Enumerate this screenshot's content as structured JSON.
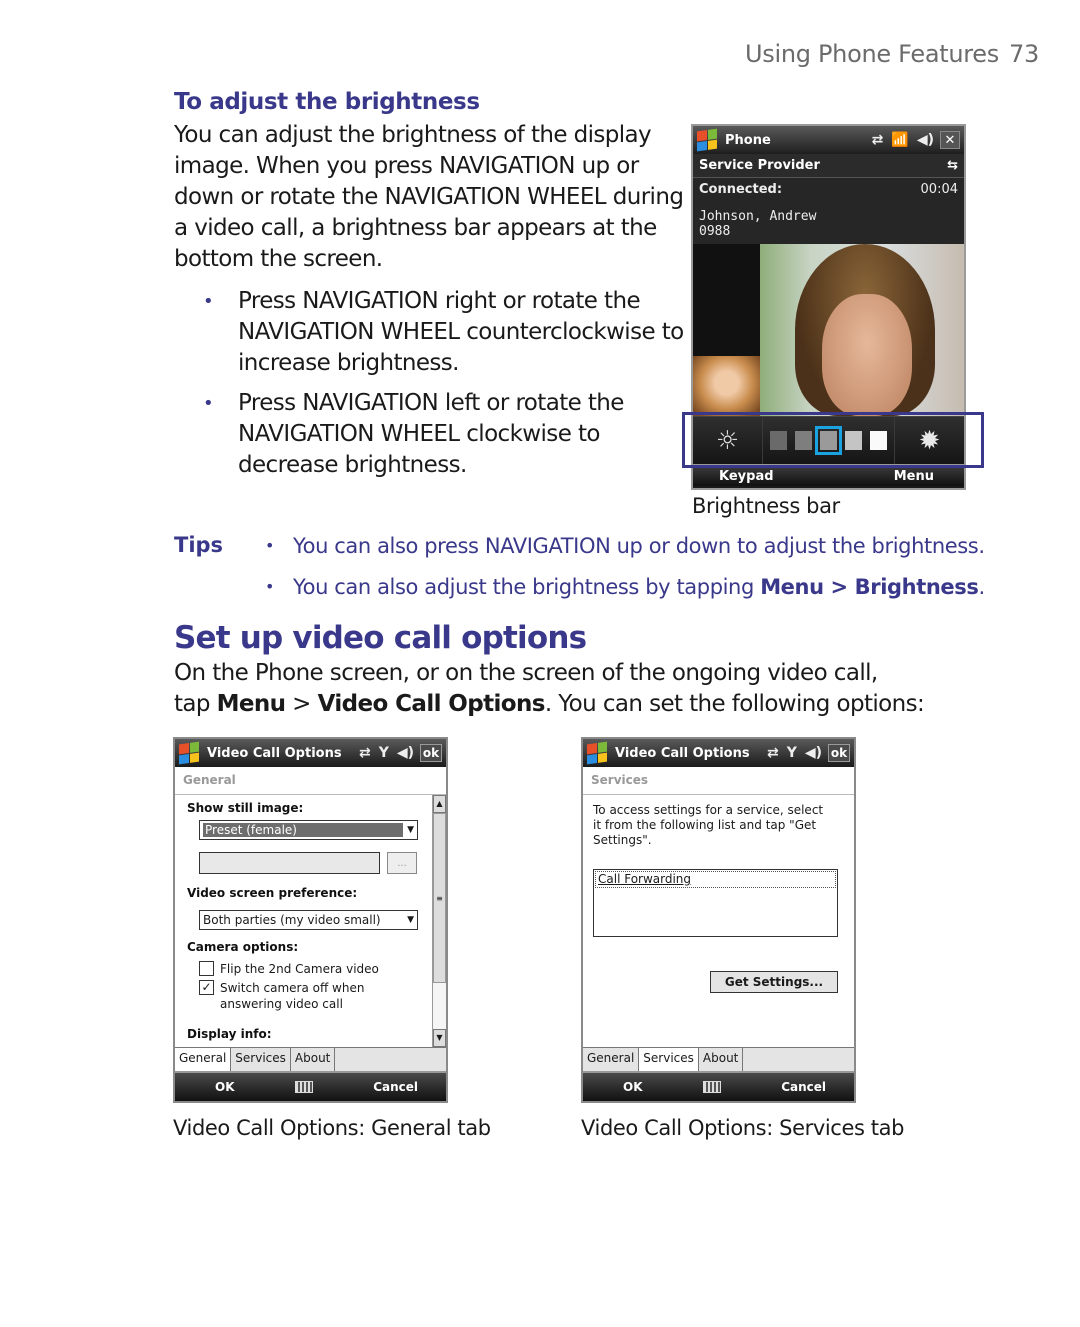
{
  "running_head": {
    "title": "Using Phone Features",
    "page": "73"
  },
  "brightness_section": {
    "heading": "To adjust the brightness",
    "intro": "You can adjust the brightness of the display image. When you press NAVIGATION up or down or rotate the NAVIGATION WHEEL during a video call, a brightness bar appears at the bottom the screen.",
    "bullets": [
      "Press NAVIGATION right or rotate the NAVIGATION WHEEL counterclockwise to increase brightness.",
      "Press NAVIGATION left or rotate the NAVIGATION WHEEL clockwise to decrease brightness."
    ]
  },
  "phone_screen": {
    "title": "Phone",
    "service_provider": "Service Provider",
    "status": "Connected:",
    "timer": "00:04",
    "contact_name": "Johnson, Andrew",
    "contact_number": "0988",
    "brightness_levels": [
      "#6a6a6a",
      "#7e7e7e",
      "#9a9a9a",
      "#c4c4c4",
      "#fafafa"
    ],
    "brightness_selected_index": 2,
    "brightness_level_count": 5,
    "softkeys": {
      "left": "Keypad",
      "right": "Menu"
    },
    "icons": {
      "close": "✕",
      "sun_dim": "☼",
      "sun_bright": "✹"
    }
  },
  "brightness_caption": "Brightness bar",
  "tips": {
    "label": "Tips",
    "items": [
      {
        "text": "You can also press NAVIGATION up or down to adjust the brightness."
      },
      {
        "pre": "You can also adjust the brightness by tapping ",
        "b1": "Menu",
        "mid": " > ",
        "b2": "Brightness",
        "post": "."
      }
    ]
  },
  "video_options_section": {
    "heading": "Set up video call options",
    "line1": "On the Phone screen, or on the screen of the ongoing video call,",
    "pre": "tap ",
    "b1": "Menu",
    "mid": " > ",
    "b2": "Video Call Options",
    "post": ". You can set the following options:"
  },
  "general_dialog": {
    "title": "Video Call Options",
    "ok": "ok",
    "subtitle": "General",
    "show_still_image_label": "Show still image:",
    "still_image_value": "Preset (female)",
    "ellipsis": "...",
    "video_pref_label": "Video screen preference:",
    "video_pref_value": "Both parties (my video small)",
    "camera_options_label": "Camera options:",
    "flip_label": "Flip the 2nd Camera video",
    "flip_checked": false,
    "switch_off_label": "Switch camera off when answering video call",
    "switch_off_checked": true,
    "display_info_label": "Display info:",
    "tabs": [
      "General",
      "Services",
      "About"
    ],
    "active_tab": "General",
    "softkeys": {
      "left": "OK",
      "right": "Cancel"
    }
  },
  "general_caption": "Video Call Options: General tab",
  "services_dialog": {
    "title": "Video Call Options",
    "ok": "ok",
    "subtitle": "Services",
    "instruction": "To access settings for a service, select it from the following list and tap \"Get Settings\".",
    "list_items": [
      "Call Forwarding"
    ],
    "get_settings": "Get Settings...",
    "tabs": [
      "General",
      "Services",
      "About"
    ],
    "active_tab": "Services",
    "softkeys": {
      "left": "OK",
      "right": "Cancel"
    }
  },
  "services_caption": "Video Call Options: Services tab",
  "colors": {
    "accent": "#39388a",
    "selection": "#1aa3e0"
  }
}
